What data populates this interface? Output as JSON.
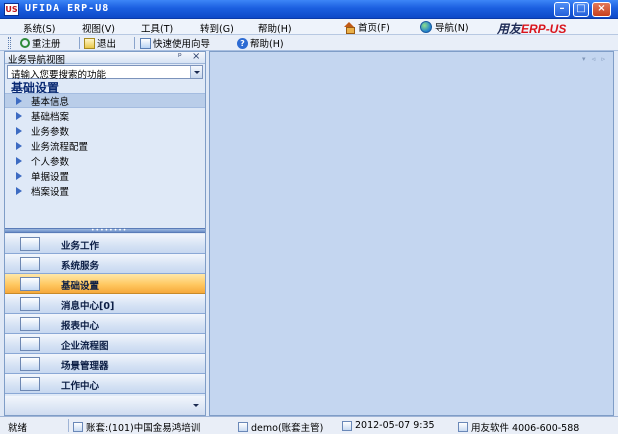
{
  "window": {
    "title": "UFIDA ERP-U8",
    "icon_text": "US",
    "buttons": [
      "minimize",
      "maximize",
      "close"
    ]
  },
  "menu": {
    "items": [
      {
        "label": "系统(S)"
      },
      {
        "label": "视图(V)"
      },
      {
        "label": "工具(T)"
      },
      {
        "label": "转到(G)"
      },
      {
        "label": "帮助(H)"
      }
    ],
    "home_label": "首页(F)",
    "guide_label": "导航(N)",
    "brand_prefix": "用友",
    "brand_suffix": "ERP-US"
  },
  "toolbar": {
    "items": [
      {
        "label": "重注册",
        "icon": "refresh-icon"
      },
      {
        "label": "退出",
        "icon": "exit-icon"
      },
      {
        "label": "快速使用向导",
        "icon": "wizard-icon"
      },
      {
        "label": "帮助(H)",
        "icon": "help-icon"
      }
    ]
  },
  "nav_panel": {
    "title": "业务导航视图",
    "pin_glyph": "ᵖ",
    "close_glyph": "×",
    "search_text": "请输入您要搜索的功能",
    "section_title": "基础设置",
    "tree_items": [
      {
        "label": "基本信息",
        "selected": true
      },
      {
        "label": "基础档案",
        "selected": false
      },
      {
        "label": "业务参数",
        "selected": false
      },
      {
        "label": "业务流程配置",
        "selected": false
      },
      {
        "label": "个人参数",
        "selected": false
      },
      {
        "label": "单据设置",
        "selected": false
      },
      {
        "label": "档案设置",
        "selected": false
      }
    ],
    "modules": [
      {
        "label": "业务工作",
        "active": false
      },
      {
        "label": "系统服务",
        "active": false
      },
      {
        "label": "基础设置",
        "active": true
      },
      {
        "label": "消息中心[0]",
        "active": false
      },
      {
        "label": "报表中心",
        "active": false
      },
      {
        "label": "企业流程图",
        "active": false
      },
      {
        "label": "场景管理器",
        "active": false
      },
      {
        "label": "工作中心",
        "active": false
      }
    ]
  },
  "workspace": {
    "controls": "▾ ◃ ▹"
  },
  "status": {
    "ready": "就绪",
    "account": "账套:(101)中国金易鸿培训",
    "user": "demo(账套主管)",
    "date": "2012-05-07 9:35",
    "company": "用友软件 4006-600-588"
  },
  "colors": {
    "titlebar": "#1b5fe0",
    "active_module": "#ffc861",
    "workspace_bg": "#c4d6f0",
    "brand_red": "#d9141c"
  }
}
